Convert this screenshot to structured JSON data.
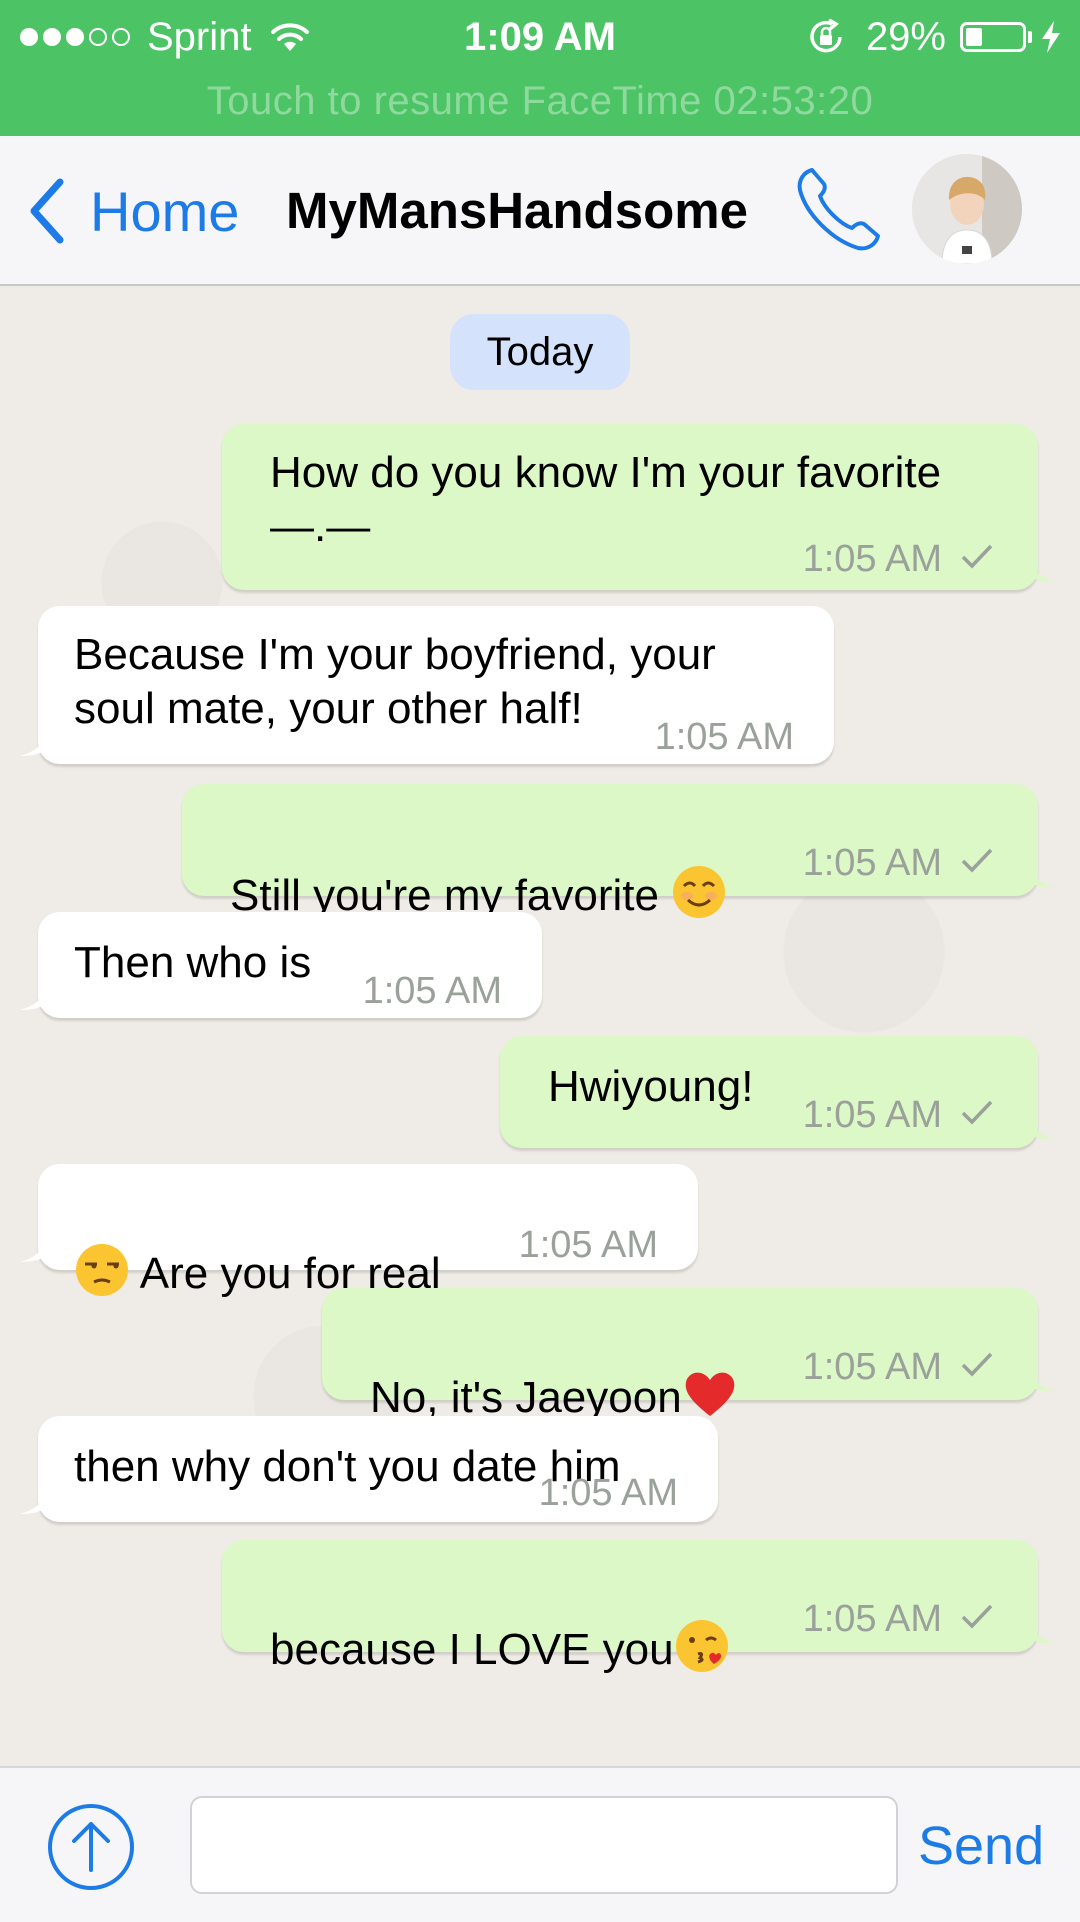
{
  "status_bar": {
    "carrier": "Sprint",
    "time": "1:09 AM",
    "battery_percent": "29%",
    "battery_level": 0.29,
    "signal_bars_filled": 3,
    "signal_bars_total": 5,
    "facetime_banner": "Touch to resume FaceTime 02:53:20"
  },
  "nav": {
    "back_label": "Home",
    "title": "MyMansHandsome"
  },
  "chat": {
    "date_label": "Today",
    "messages": [
      {
        "direction": "out",
        "text": "How do you know I'm your favorite\n—.—",
        "time": "1:05 AM"
      },
      {
        "direction": "in",
        "text": "Because I'm your boyfriend, your\nsoul mate, your other half!",
        "time": "1:05 AM"
      },
      {
        "direction": "out",
        "text": "Still you're my favorite ",
        "emoji": "smiling-face-emoji",
        "time": "1:05 AM"
      },
      {
        "direction": "in",
        "text": "Then who is",
        "time": "1:05 AM"
      },
      {
        "direction": "out",
        "text": "Hwiyoung!",
        "time": "1:05 AM"
      },
      {
        "direction": "in",
        "text": " Are you for real",
        "emoji_before": "unamused-face-emoji",
        "time": "1:05 AM"
      },
      {
        "direction": "out",
        "text": "No, it's Jaeyoon",
        "emoji": "red-heart-emoji",
        "time": "1:05 AM"
      },
      {
        "direction": "in",
        "text": "then why don't you date him",
        "time": "1:05 AM"
      },
      {
        "direction": "out",
        "text": "because I LOVE you",
        "emoji": "kissing-face-emoji",
        "time": "1:05 AM"
      }
    ]
  },
  "input": {
    "placeholder": "",
    "value": "",
    "send_label": "Send"
  },
  "colors": {
    "status_bar": "#4cc466",
    "accent": "#1d7be8",
    "outgoing_bubble": "#dcf8c6",
    "incoming_bubble": "#ffffff",
    "date_chip": "#d4e2fb"
  }
}
